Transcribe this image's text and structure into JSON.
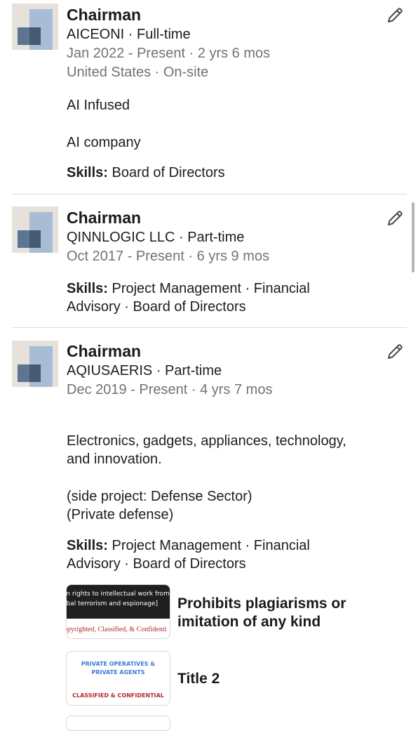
{
  "entries": [
    {
      "title": "Chairman",
      "company_line": "AICEONI · Full-time",
      "dates": "Jan 2022 - Present · 2 yrs 6 mos",
      "location": "United States · On-site",
      "description": [
        "AI Infused",
        "AI company"
      ],
      "skills_label": "Skills:",
      "skills_lines": [
        " Board of Directors"
      ]
    },
    {
      "title": "Chairman",
      "company_line": "QINNLOGIC LLC · Part-time",
      "dates": "Oct 2017 - Present · 6 yrs 9 mos",
      "skills_label": "Skills:",
      "skills_lines": [
        " Project Management · Financial",
        "Advisory · Board of Directors"
      ]
    },
    {
      "title": "Chairman",
      "company_line": "AQIUSAERIS · Part-time",
      "dates": "Dec 2019 - Present · 4 yrs 7 mos",
      "description": [
        "Electronics, gadgets, appliances, technology,",
        "and innovation.",
        "(side project: Defense Sector)",
        "(Private defense)"
      ],
      "skills_label": "Skills:",
      "skills_lines": [
        " Project Management · Financial",
        "Advisory · Board of Directors"
      ],
      "media": [
        {
          "title_lines": [
            "Prohibits plagiarisms or",
            "imitation of any kind"
          ],
          "thumb_lines": [
            "vn rights to intellectual work from",
            "obal terrorism and espionage]"
          ],
          "thumb_footer": "opyrighted, Classified, & Confidenti"
        },
        {
          "title_lines": [
            "Title 2"
          ],
          "thumb_lines": [
            "PRIVATE OPERATIVES &",
            "PRIVATE AGENTS"
          ],
          "thumb_footer": "CLASSIFIED & CONFIDENTIAL"
        }
      ]
    }
  ],
  "icons": {
    "edit": "pencil-icon",
    "logo": "company-logo"
  },
  "colors": {
    "secondary_text": "#737373",
    "divider": "#dcdcdc",
    "logo_light": "#a7bdd6",
    "logo_dark": "#5d7593"
  }
}
